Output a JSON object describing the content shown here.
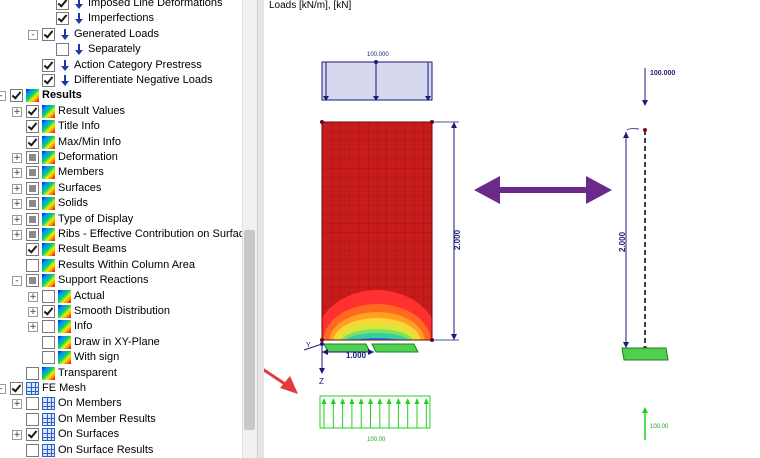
{
  "tree": {
    "items": [
      {
        "label": "Imposed Line Deformations",
        "level": 3,
        "check": "on",
        "icon": "load",
        "exp": "",
        "bold": false
      },
      {
        "label": "Imperfections",
        "level": 3,
        "check": "on",
        "icon": "load",
        "exp": "",
        "bold": false
      },
      {
        "label": "Generated Loads",
        "level": 2,
        "check": "on",
        "icon": "load",
        "exp": "-",
        "bold": false
      },
      {
        "label": "Separately",
        "level": 3,
        "check": "off",
        "icon": "load",
        "exp": "",
        "bold": false
      },
      {
        "label": "Action Category Prestress",
        "level": 2,
        "check": "on",
        "icon": "load",
        "exp": "",
        "bold": false
      },
      {
        "label": "Differentiate Negative Loads",
        "level": 2,
        "check": "on",
        "icon": "load",
        "exp": "",
        "bold": false
      },
      {
        "label": "Results",
        "level": 0,
        "check": "on",
        "icon": "rainbow",
        "exp": "-",
        "bold": true
      },
      {
        "label": "Result Values",
        "level": 1,
        "check": "on",
        "icon": "rainbow",
        "exp": "+",
        "bold": false
      },
      {
        "label": "Title Info",
        "level": 1,
        "check": "on",
        "icon": "rainbow",
        "exp": "",
        "bold": false
      },
      {
        "label": "Max/Min Info",
        "level": 1,
        "check": "on",
        "icon": "rainbow",
        "exp": "",
        "bold": false
      },
      {
        "label": "Deformation",
        "level": 1,
        "check": "part",
        "icon": "rainbow",
        "exp": "+",
        "bold": false
      },
      {
        "label": "Members",
        "level": 1,
        "check": "part",
        "icon": "rainbow",
        "exp": "+",
        "bold": false
      },
      {
        "label": "Surfaces",
        "level": 1,
        "check": "part",
        "icon": "rainbow",
        "exp": "+",
        "bold": false
      },
      {
        "label": "Solids",
        "level": 1,
        "check": "part",
        "icon": "rainbow",
        "exp": "+",
        "bold": false
      },
      {
        "label": "Type of Display",
        "level": 1,
        "check": "part",
        "icon": "rainbow",
        "exp": "+",
        "bold": false
      },
      {
        "label": "Ribs - Effective Contribution on Surfac",
        "level": 1,
        "check": "part",
        "icon": "rainbow",
        "exp": "+",
        "bold": false
      },
      {
        "label": "Result Beams",
        "level": 1,
        "check": "on",
        "icon": "rainbow",
        "exp": "",
        "bold": false
      },
      {
        "label": "Results Within Column Area",
        "level": 1,
        "check": "off",
        "icon": "rainbow",
        "exp": "",
        "bold": false
      },
      {
        "label": "Support Reactions",
        "level": 1,
        "check": "part",
        "icon": "rainbow",
        "exp": "-",
        "bold": false
      },
      {
        "label": "Actual",
        "level": 2,
        "check": "off",
        "icon": "rainbow",
        "exp": "+",
        "bold": false
      },
      {
        "label": "Smooth Distribution",
        "level": 2,
        "check": "on",
        "icon": "rainbow",
        "exp": "+",
        "bold": false
      },
      {
        "label": "Info",
        "level": 2,
        "check": "off",
        "icon": "rainbow",
        "exp": "+",
        "bold": false
      },
      {
        "label": "Draw in XY-Plane",
        "level": 2,
        "check": "off",
        "icon": "rainbow",
        "exp": "",
        "bold": false
      },
      {
        "label": "With sign",
        "level": 2,
        "check": "off",
        "icon": "rainbow",
        "exp": "",
        "bold": false
      },
      {
        "label": "Transparent",
        "level": 1,
        "check": "off",
        "icon": "rainbow",
        "exp": "",
        "bold": false
      },
      {
        "label": "FE Mesh",
        "level": 0,
        "check": "on",
        "icon": "grid",
        "exp": "-",
        "bold": false
      },
      {
        "label": "On Members",
        "level": 1,
        "check": "off",
        "icon": "grid",
        "exp": "+",
        "bold": false
      },
      {
        "label": "On Member Results",
        "level": 1,
        "check": "off",
        "icon": "grid",
        "exp": "",
        "bold": false
      },
      {
        "label": "On Surfaces",
        "level": 1,
        "check": "on",
        "icon": "grid",
        "exp": "+",
        "bold": false
      },
      {
        "label": "On Surface Results",
        "level": 1,
        "check": "off",
        "icon": "grid",
        "exp": "",
        "bold": false
      }
    ]
  },
  "graphic": {
    "title": "Loads [kN/m], [kN]",
    "load_label_surface": "100.000",
    "load_label_member": "100.000",
    "dim_height_surface": "2.000",
    "dim_height_member": "2.000",
    "dim_width": "1.000",
    "axis_z": "Z",
    "axis_y": "Y",
    "reaction_label_surface": "100.00",
    "reaction_label_member": "100.00",
    "colors": {
      "surface": "#c81c1c",
      "load": "#1a1a7a",
      "load_fill": "#d6d8ee",
      "reaction": "#20d020",
      "arrow_double": "#6a2a8a",
      "arrow_red": "#e03a3a"
    }
  }
}
